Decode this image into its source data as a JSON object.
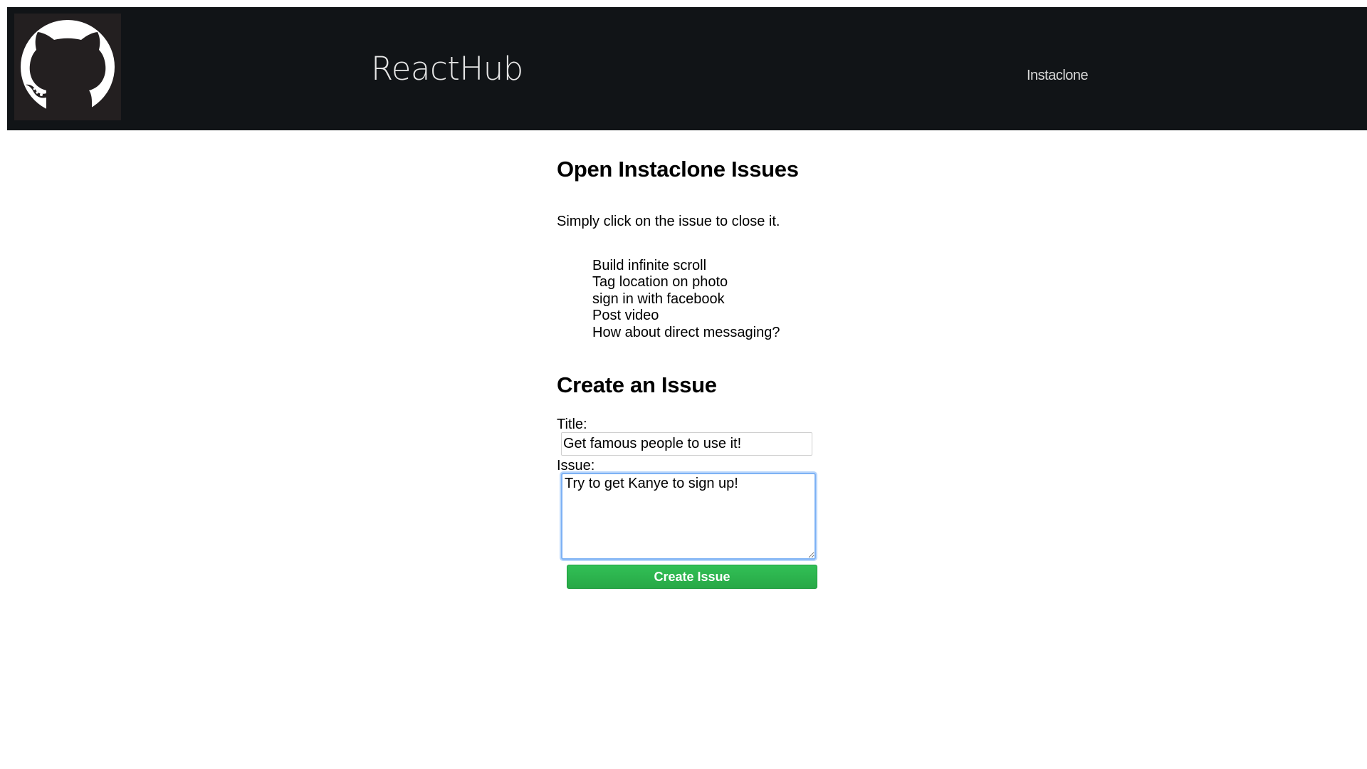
{
  "navbar": {
    "logo_icon": "github-octocat-icon",
    "brand": "ReactHub",
    "nav_link": "Instaclone",
    "background_color": "#111417"
  },
  "open_issues": {
    "heading": "Open Instaclone Issues",
    "instructions": "Simply click on the issue to close it.",
    "items": [
      "Build infinite scroll",
      "Tag location on photo",
      "sign in with facebook",
      "Post video",
      "How about direct messaging?"
    ]
  },
  "create_issue": {
    "heading": "Create an Issue",
    "title_label": "Title:",
    "title_value": "Get famous people to use it!",
    "issue_label": "Issue:",
    "issue_value": "Try to get Kanye to sign up!",
    "submit_label": "Create Issue",
    "submit_color": "#2cb34e"
  }
}
